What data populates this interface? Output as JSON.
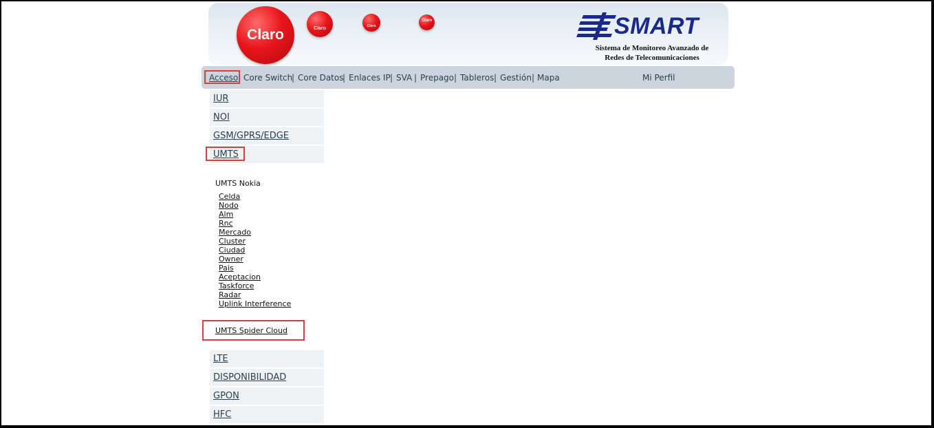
{
  "header": {
    "brand_ball_text": "Claro",
    "small_ball_text": "Claro",
    "smart_title": "SMART",
    "tagline_line1": "Sistema de Monitoreo Avanzado de",
    "tagline_line2": "Redes de Telecomunicaciones",
    "brand_red": "#e8161b",
    "smart_blue": "#1a2a8c"
  },
  "nav": {
    "items": [
      {
        "label": "Acceso",
        "active": true
      },
      {
        "label": "Core Switch"
      },
      {
        "label": "Core Datos"
      },
      {
        "label": "Enlaces IP"
      },
      {
        "label": "SVA"
      },
      {
        "label": "Prepago"
      },
      {
        "label": "Tableros"
      },
      {
        "label": "Gestión"
      },
      {
        "label": "Mapa"
      }
    ],
    "separator": "|",
    "profile_label": "Mi Perfil"
  },
  "menu": {
    "top_items": [
      "IUR",
      "NOI",
      "GSM/GPRS/EDGE",
      "UMTS"
    ],
    "bottom_items": [
      "LTE",
      "DISPONIBILIDAD",
      "GPON",
      "HFC"
    ],
    "umts_submenu": {
      "title": "UMTS Nokia",
      "links": [
        "Celda",
        "Nodo",
        "Alm",
        "Rnc",
        "Mercado",
        "Cluster",
        "Ciudad",
        "Owner",
        "Pais",
        "Aceptacion",
        "Taskforce",
        "Radar",
        "Uplink Interference"
      ],
      "spider_cloud_label": "UMTS Spider Cloud"
    }
  },
  "highlight_color": "#e03c3c"
}
